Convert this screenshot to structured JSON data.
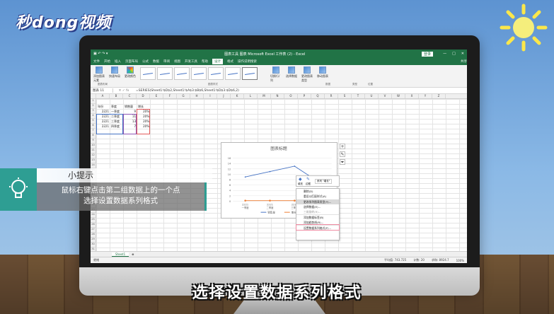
{
  "brand": {
    "logo": "秒dong视频"
  },
  "excel": {
    "title": "图表工具     图表 Microsoft Excel 工作表 (2) - Excel",
    "login": "登录",
    "tabs": [
      "文件",
      "开始",
      "插入",
      "页面布局",
      "公式",
      "数据",
      "审阅",
      "视图",
      "开发工具",
      "帮助",
      "设计",
      "格式",
      "操作说明搜索"
    ],
    "active_tab": "设计",
    "share": "共享",
    "ribbon": {
      "add_element": "添加图表元素",
      "quick_layout": "快速布局",
      "change_colors": "更改颜色",
      "layouts_group": "图表布局",
      "styles_group": "图表样式",
      "switch_row_col": "切换行/列",
      "select_data": "选择数据",
      "data_group": "数据",
      "change_type": "更改图表类型",
      "type_group": "类型",
      "move_chart": "移动图表",
      "location_group": "位置"
    },
    "namebox": "图表 11",
    "formula": "=SERIES(Sheet1!$D$2,Sheet1!$A$3:$B$6,Sheet1!$D$3:$D$6,2)",
    "columns": [
      "A",
      "B",
      "C",
      "D",
      "E",
      "F",
      "G",
      "H",
      "I",
      "J",
      "K",
      "L",
      "M",
      "N",
      "O",
      "P",
      "Q",
      "R",
      "S",
      "T",
      "U",
      "V",
      "W",
      "X",
      "Y",
      "Z"
    ],
    "table": {
      "headers": [
        "年份",
        "季度",
        "销售量",
        "增长"
      ],
      "rows": [
        [
          "2221",
          "一季度",
          "9",
          "20%"
        ],
        [
          "2221",
          "二季度",
          "11",
          "20%"
        ],
        [
          "2221",
          "三季度",
          "13",
          "20%"
        ],
        [
          "2221",
          "四季度",
          "7",
          "20%"
        ]
      ]
    },
    "sheet_tab": "Sheet1",
    "status": {
      "mode": "就绪",
      "avg": "平均值: 743.725",
      "count": "计数: 20",
      "sum": "求和: 8924.7",
      "zoom": "100%"
    }
  },
  "chart_data": {
    "type": "line",
    "title": "图表标题",
    "categories": [
      "2221 一季度",
      "2221 二季度",
      "2221 三季度",
      "2221 四季度"
    ],
    "series": [
      {
        "name": "销售量",
        "values": [
          9,
          11,
          13,
          7
        ],
        "color": "#4472c4"
      },
      {
        "name": "增长",
        "values": [
          0.2,
          0.2,
          0.2,
          0.2
        ],
        "color": "#ed7d31"
      }
    ],
    "ylim": [
      0,
      16
    ],
    "yticks": [
      0,
      2,
      4,
      6,
      8,
      10,
      12,
      14,
      16
    ],
    "xticklabels": [
      "2221",
      "2221",
      "2221",
      "2221"
    ],
    "xsublabels": [
      "一季度",
      "二季度",
      "三季度",
      "四季度"
    ],
    "legend": "bottom",
    "grid": true
  },
  "minibar": {
    "fill": "填充",
    "outline": "边框",
    "series": "系列 \"增长\""
  },
  "context_menu": [
    "删除(D)",
    "重设以匹配样式(A)",
    "更改系列图表类型(Y)...",
    "选择数据(E)...",
    "三维旋转(R)...",
    "添加数据标签(B)",
    "添加趋势线(R)...",
    "设置数据系列格式(F)..."
  ],
  "overlay": {
    "tip_title": "小提示",
    "tip_line1": "鼠标右键点击第二组数据上的一个点",
    "tip_line2": "选择设置数据系列格式",
    "subtitle": "选择设置数据系列格式"
  }
}
